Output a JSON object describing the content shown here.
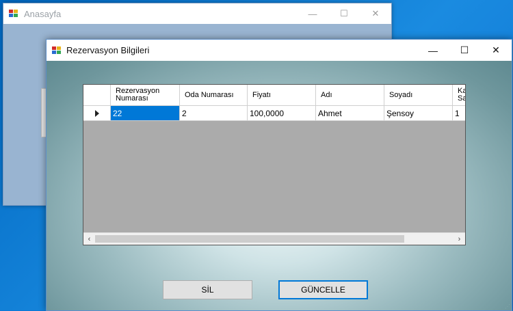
{
  "back_window": {
    "title": "Anasayfa",
    "controls": {
      "minimize": "—",
      "maximize": "☐",
      "close": "✕"
    }
  },
  "front_window": {
    "title": "Rezervasyon Bilgileri",
    "controls": {
      "minimize": "—",
      "maximize": "☐",
      "close": "✕"
    }
  },
  "grid": {
    "columns": [
      "Rezervasyon Numarası",
      "Oda Numarası",
      "Fiyatı",
      "Adı",
      "Soyadı",
      "Ka Sa"
    ],
    "rows": [
      {
        "values": [
          "22",
          "2",
          "100,0000",
          "Ahmet",
          "Şensoy",
          "1"
        ],
        "selected_col": 0
      }
    ],
    "scrollbar": {
      "left_arrow": "‹",
      "right_arrow": "›"
    }
  },
  "buttons": {
    "delete_label": "SİL",
    "update_label": "GÜNCELLE"
  },
  "colors": {
    "selection": "#0078d7",
    "grid_background": "#ababab"
  }
}
